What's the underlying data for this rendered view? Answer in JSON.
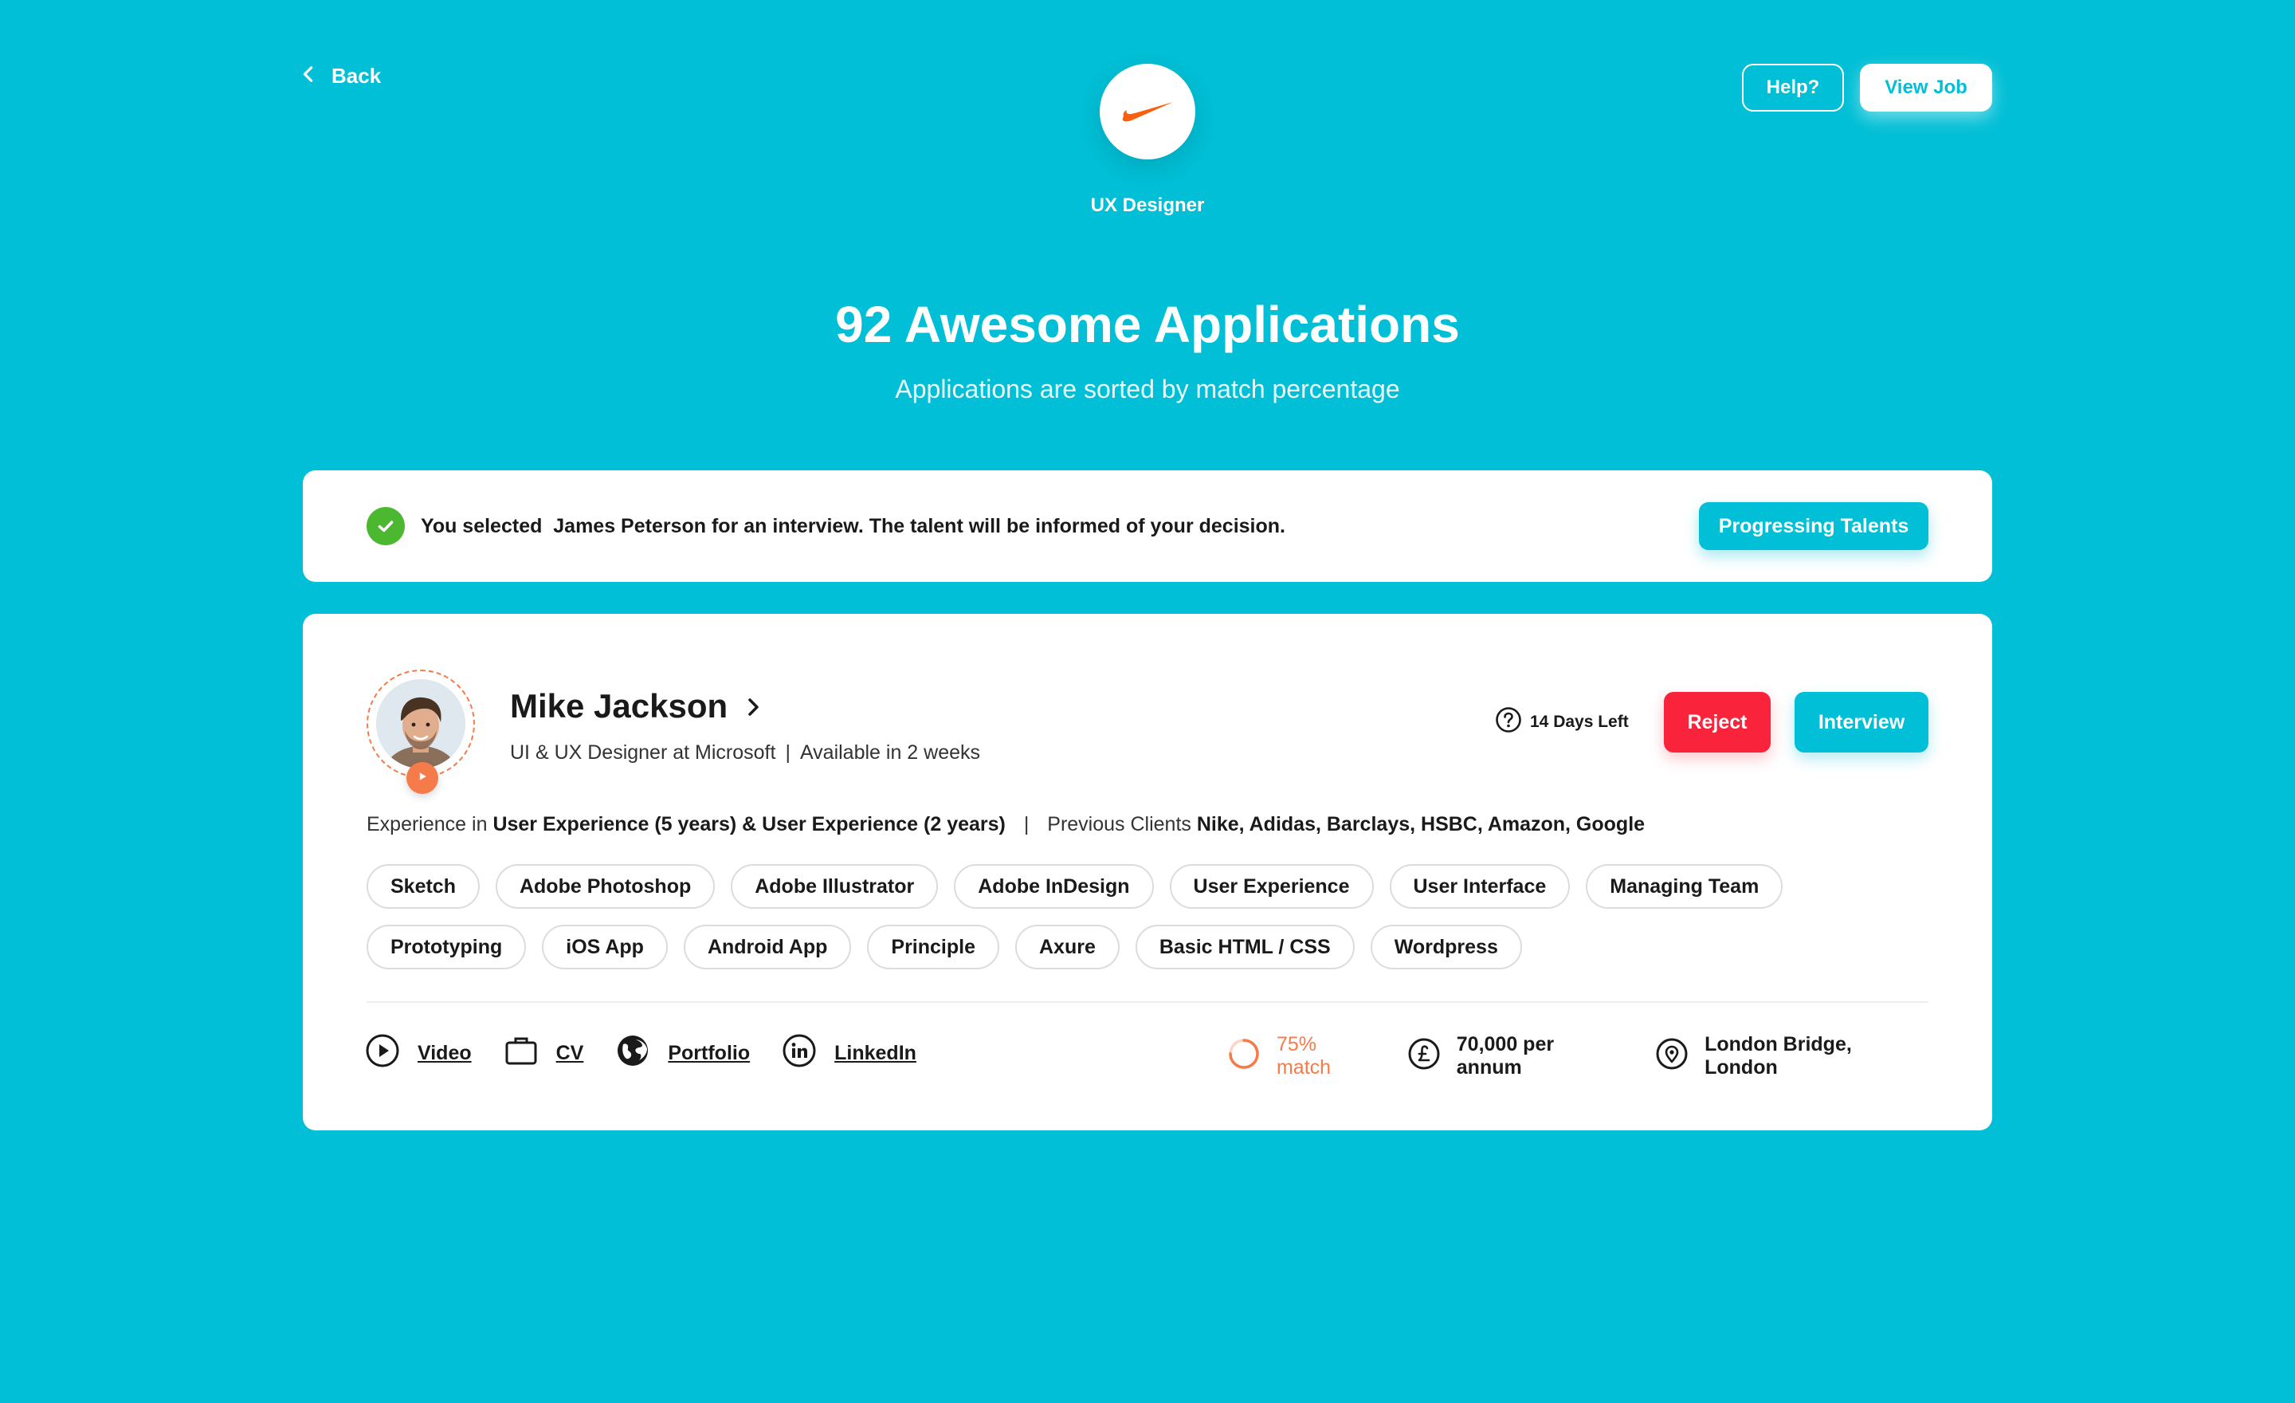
{
  "header": {
    "back_label": "Back",
    "job_title": "UX Designer",
    "help_label": "Help?",
    "view_job_label": "View Job",
    "headline": "92 Awesome Applications",
    "subheadline": "Applications are sorted by match percentage",
    "logo_icon": "swoosh-logo",
    "brand_color": "#00BFD6"
  },
  "notice": {
    "message": "You selected  James Peterson for an interview. The talent will be informed of your decision.",
    "action_label": "Progressing Talents",
    "status_color": "#4CB82F"
  },
  "candidate": {
    "name": "Mike Jackson",
    "role": "UI & UX Designer at Microsoft",
    "availability": "Available in 2 weeks",
    "days_left": "14 Days Left",
    "reject_label": "Reject",
    "interview_label": "Interview",
    "experience_prefix": "Experience in",
    "experience": "User Experience (5 years) & User Experience (2 years)",
    "clients_prefix": "Previous Clients",
    "clients": "Nike, Adidas, Barclays, HSBC, Amazon, Google",
    "skills": [
      "Sketch",
      "Adobe Photoshop",
      "Adobe Illustrator",
      "Adobe InDesign",
      "User Experience",
      "User Interface",
      "Managing Team",
      "Prototyping",
      "iOS App",
      "Android App",
      "Principle",
      "Axure",
      "Basic HTML / CSS",
      "Wordpress"
    ],
    "links": {
      "video": "Video",
      "cv": "CV",
      "portfolio": "Portfolio",
      "linkedin": "LinkedIn"
    },
    "match_percent": 75,
    "match_label": "75% match",
    "salary": "70,000 per annum",
    "location": "London Bridge, London",
    "reject_color": "#F9233B",
    "match_color": "#F57B4A"
  }
}
